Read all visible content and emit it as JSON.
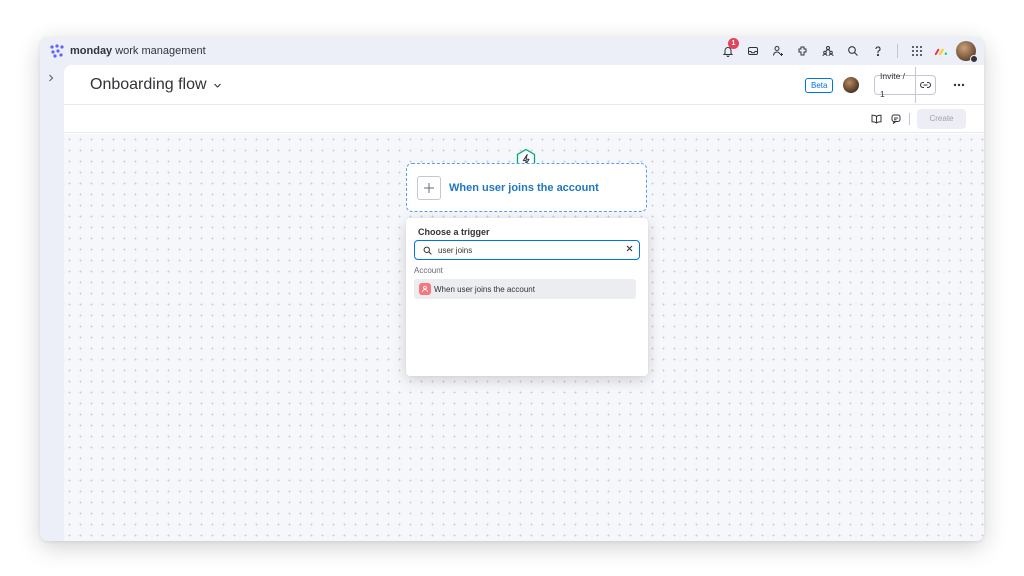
{
  "app": {
    "brand_name": "monday",
    "brand_sub": "work management"
  },
  "topbar": {
    "icons": [
      "bell-icon",
      "inbox-icon",
      "invite-members-icon",
      "integrations-icon",
      "people-icon",
      "search-icon",
      "help-icon",
      "apps-grid-icon"
    ],
    "notification_count": "1"
  },
  "board": {
    "title": "Onboarding flow",
    "beta_label": "Beta",
    "invite_label": "Invite / 1"
  },
  "toolbar": {
    "create_label": "Create"
  },
  "workflow": {
    "trigger_title": "When user joins the account"
  },
  "trigger_picker": {
    "title": "Choose a trigger",
    "search_value": "user joins",
    "group_label": "Account",
    "options": [
      {
        "label": "When user joins the account"
      }
    ]
  },
  "colors": {
    "accent": "#0073ea",
    "trigger_text": "#1f76c2",
    "notification_badge": "#e2445c",
    "hex_icon": "#00a878"
  }
}
